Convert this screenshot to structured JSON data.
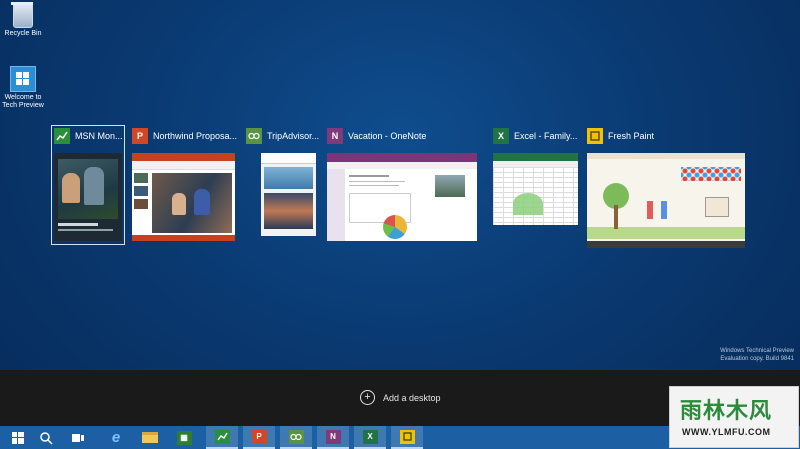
{
  "desktop_icons": [
    {
      "label": "Recycle Bin",
      "icon": "recycle-bin-icon"
    },
    {
      "label": "Welcome to Tech Preview",
      "icon": "windows-logo-icon"
    }
  ],
  "task_view": {
    "windows": [
      {
        "title": "MSN Mon...",
        "app": "MSN Money",
        "icon_color": "#2a8f3a",
        "selected": true
      },
      {
        "title": "Northwind Proposa...",
        "app": "PowerPoint",
        "icon_color": "#d24726"
      },
      {
        "title": "TripAdvisor...",
        "app": "TripAdvisor",
        "icon_color": "#589442"
      },
      {
        "title": "Vacation - OneNote",
        "app": "OneNote",
        "icon_color": "#80397b"
      },
      {
        "title": "Excel - Family...",
        "app": "Excel",
        "icon_color": "#217346"
      },
      {
        "title": "Fresh Paint",
        "app": "Fresh Paint",
        "icon_color": "#f2c200"
      }
    ],
    "add_desktop_label": "Add a desktop"
  },
  "watermark": {
    "line1": "Windows Technical Preview",
    "line2": "Evaluation copy. Build 9841"
  },
  "taskbar": {
    "items": [
      {
        "name": "start",
        "icon": "windows-logo-icon"
      },
      {
        "name": "search",
        "icon": "search-icon"
      },
      {
        "name": "task-view",
        "icon": "task-view-icon"
      },
      {
        "name": "internet-explorer",
        "icon": "internet-explorer-icon"
      },
      {
        "name": "file-explorer",
        "icon": "folder-icon"
      },
      {
        "name": "store",
        "icon": "store-icon"
      },
      {
        "name": "msn-money",
        "icon": "money-chart-icon",
        "active": true
      },
      {
        "name": "powerpoint",
        "icon": "powerpoint-icon",
        "active": true
      },
      {
        "name": "tripadvisor",
        "icon": "tripadvisor-icon",
        "active": true
      },
      {
        "name": "onenote",
        "icon": "onenote-icon",
        "active": true
      },
      {
        "name": "excel",
        "icon": "excel-icon",
        "active": true
      },
      {
        "name": "fresh-paint",
        "icon": "fresh-paint-icon",
        "active": true
      }
    ]
  },
  "brand_overlay": {
    "name": "雨林木风",
    "url": "WWW.YLMFU.COM"
  }
}
